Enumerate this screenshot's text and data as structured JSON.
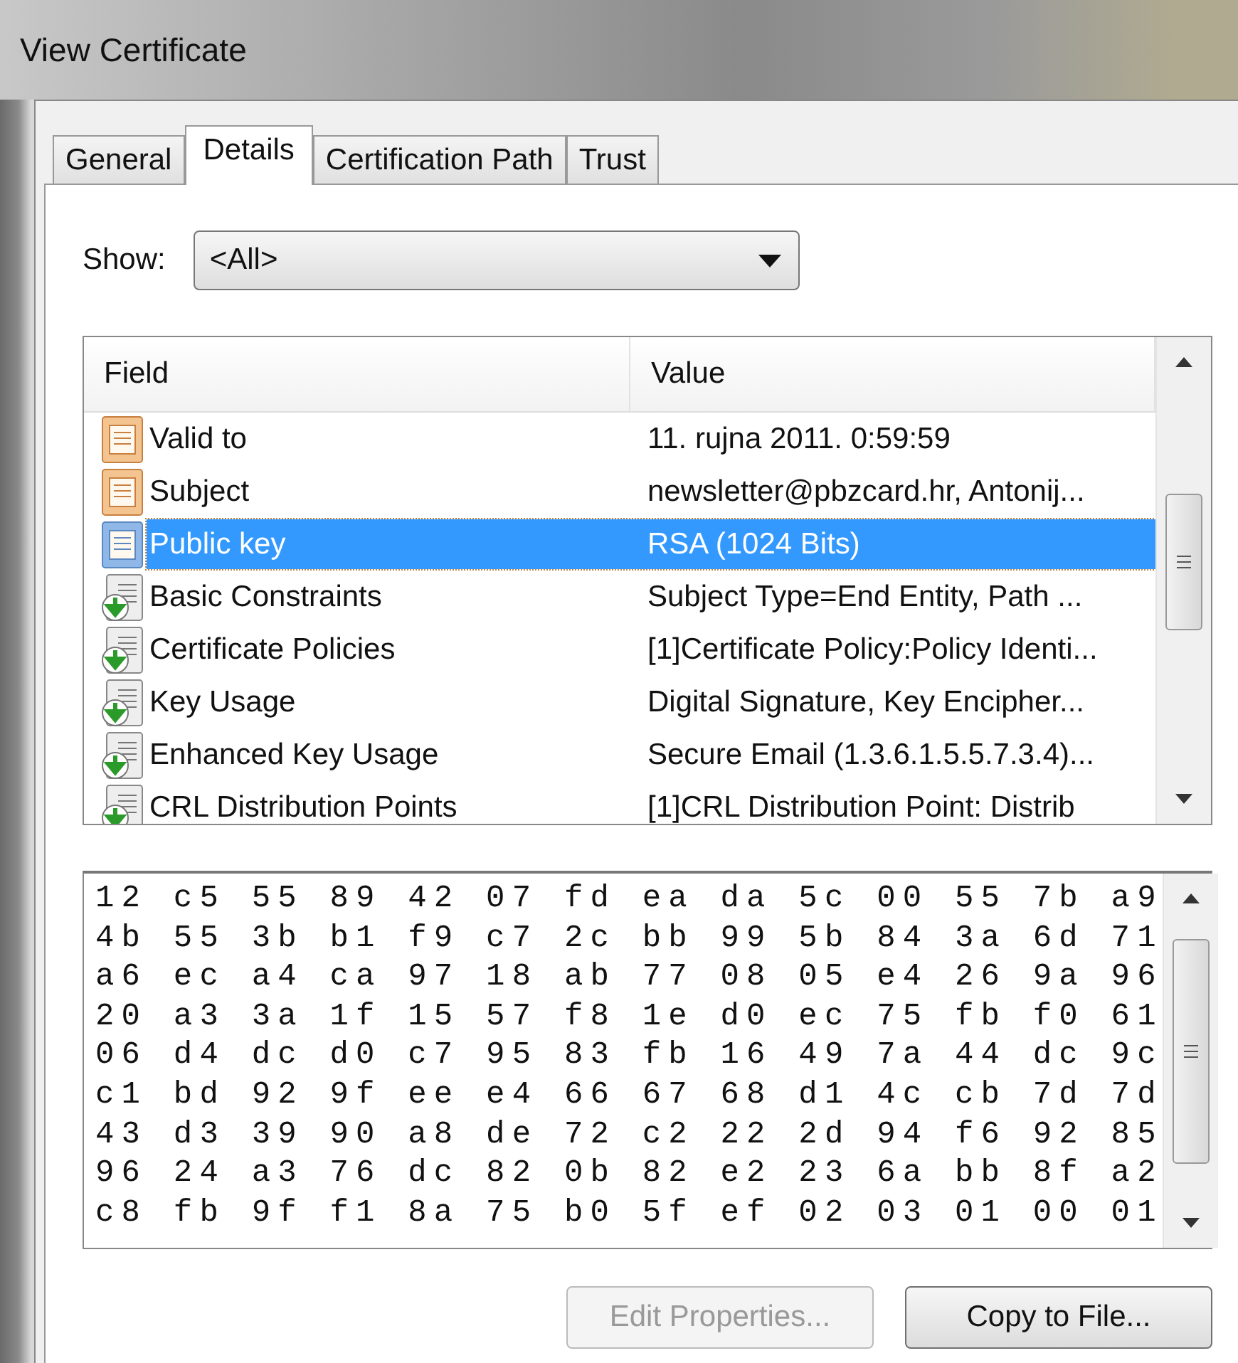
{
  "window": {
    "title": "View Certificate"
  },
  "tabs": [
    {
      "label": "General",
      "selected": false
    },
    {
      "label": "Details",
      "selected": true
    },
    {
      "label": "Certification Path",
      "selected": false
    },
    {
      "label": "Trust",
      "selected": false
    }
  ],
  "show": {
    "label": "Show:",
    "value": "<All>"
  },
  "fields_table": {
    "columns": [
      "Field",
      "Value"
    ],
    "rows": [
      {
        "kind": "property",
        "field": "Valid to",
        "value": "11. rujna 2011. 0:59:59",
        "selected": false
      },
      {
        "kind": "property",
        "field": "Subject",
        "value": "newsletter@pbzcard.hr, Antonij...",
        "selected": false
      },
      {
        "kind": "property",
        "field": "Public key",
        "value": "RSA (1024 Bits)",
        "selected": true
      },
      {
        "kind": "extension",
        "field": "Basic Constraints",
        "value": "Subject Type=End Entity, Path ...",
        "selected": false
      },
      {
        "kind": "extension",
        "field": "Certificate Policies",
        "value": "[1]Certificate Policy:Policy Identi...",
        "selected": false
      },
      {
        "kind": "extension",
        "field": "Key Usage",
        "value": "Digital Signature, Key Encipher...",
        "selected": false
      },
      {
        "kind": "extension",
        "field": "Enhanced Key Usage",
        "value": "Secure Email (1.3.6.1.5.5.7.3.4)...",
        "selected": false
      },
      {
        "kind": "extension",
        "field": "CRL Distribution Points",
        "value": "[1]CRL Distribution Point: Distrib",
        "selected": false
      }
    ]
  },
  "value_box": {
    "lines": [
      "12 c5 55 89 42 07 fd ea da 5c 00 55 7b a9",
      "4b 55 3b b1 f9 c7 2c bb 99 5b 84 3a 6d 71",
      "a6 ec a4 ca 97 18 ab 77 08 05 e4 26 9a 96",
      "20 a3 3a 1f 15 57 f8 1e d0 ec 75 fb f0 61",
      "06 d4 dc d0 c7 95 83 fb 16 49 7a 44 dc 9c",
      "c1 bd 92 9f ee e4 66 67 68 d1 4c cb 7d 7d",
      "43 d3 39 90 a8 de 72 c2 22 2d 94 f6 92 85",
      "96 24 a3 76 dc 82 0b 82 e2 23 6a bb 8f a2",
      "c8 fb 9f f1 8a 75 b0 5f ef 02 03 01 00 01"
    ]
  },
  "buttons": [
    {
      "label": "Edit Properties...",
      "disabled": true
    },
    {
      "label": "Copy to File...",
      "disabled": false
    }
  ]
}
